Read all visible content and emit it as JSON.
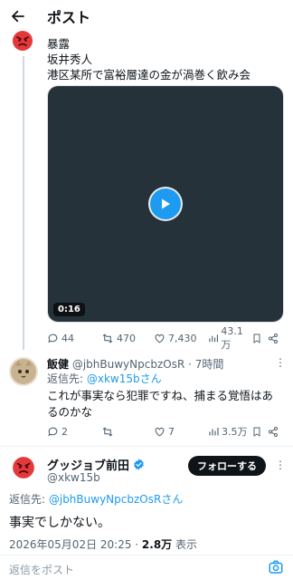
{
  "header": {
    "title": "ポスト"
  },
  "post1": {
    "lines": [
      "暴露",
      "坂井秀人",
      "港区某所で富裕層達の金が渦巻く飲み会"
    ],
    "video_duration": "0:16",
    "actions": {
      "replies": "44",
      "reposts": "470",
      "likes": "7,430",
      "views": "43.1万"
    }
  },
  "reply": {
    "name": "飯健",
    "handle": "@jbhBuwyNpcbzOsR",
    "time": "· 7時間",
    "replyto_prefix": "返信先: ",
    "replyto_handle": "@xkw15bさん",
    "text": "これが事実なら犯罪ですね、捕まる覚悟はあるのかな",
    "actions": {
      "replies": "2",
      "reposts": "",
      "likes": "7",
      "views": "3.5万"
    }
  },
  "main": {
    "name": "グッジョブ前田",
    "handle": "@xkw15b",
    "follow_label": "フォローする",
    "replyto_prefix": "返信先: ",
    "replyto_handle": "@jbhBuwyNpcbzOsRさん",
    "text": "事実でしかない。",
    "datetime": "2026年05月02日 20:25 · ",
    "views": "2.8万",
    "views_label": " 表示"
  },
  "compose": {
    "placeholder": "返信をポスト"
  },
  "colors": {
    "accent": "#1d9bf0",
    "text": "#0f1419",
    "muted": "#536471"
  }
}
